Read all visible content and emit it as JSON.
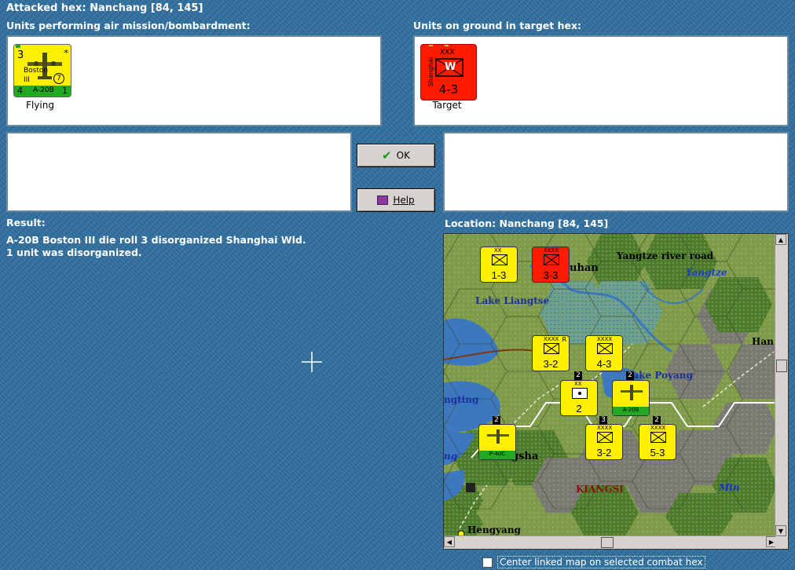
{
  "header": {
    "attacked_hex": "Attacked hex: Nanchang  [84, 145]"
  },
  "left_panel": {
    "title": "Units performing air mission/bombardment:",
    "unit": {
      "top_left": "3",
      "star": "*",
      "name": "Boston",
      "sub": "III",
      "range": "7",
      "bottom_left": "4",
      "type": "A-20B",
      "bottom_right": "1",
      "caption": "Flying"
    }
  },
  "right_panel": {
    "title": "Units on ground in target hex:",
    "unit": {
      "size": "XXX",
      "side_label": "Shanghai",
      "symbol": "W",
      "strength": "4-3",
      "caption": "Target"
    }
  },
  "buttons": {
    "ok": "OK",
    "help": "Help"
  },
  "result": {
    "title": "Result:",
    "line1": "A-20B Boston III die roll 3 disorganized Shanghai Wld.",
    "line2": "1 unit was disorganized."
  },
  "location": {
    "label": "Location:  Nanchang  [84, 145]"
  },
  "map": {
    "labels": {
      "yangtze_road": "Yangtze river road",
      "yangtze": "Yangtze",
      "han": "Han",
      "lake_liangtse": "Lake Liangtse",
      "lake_poyang": "Lake Poyang",
      "ngting": "ngting",
      "ng": "ng",
      "gsha": "gsha",
      "kiangsi": "KIANGSI",
      "min": "Min",
      "hengyang": "Hengyang",
      "uhan": "uhan"
    },
    "counters": [
      {
        "id": "c1",
        "size": "XX",
        "strength": "1-3"
      },
      {
        "id": "c2",
        "size": "XXXX",
        "strength": "3-3"
      },
      {
        "id": "c3",
        "size": "XXXX",
        "strength": "3-2",
        "extra": "R"
      },
      {
        "id": "c4",
        "size": "XXXX",
        "strength": "4-3"
      },
      {
        "id": "c5",
        "size": "XX",
        "strength": "2"
      },
      {
        "id": "c6",
        "size": "",
        "strength": "A-20B"
      },
      {
        "id": "c7",
        "size": "",
        "strength": "P-40C"
      },
      {
        "id": "c8",
        "size": "XXXX",
        "strength": "3-2"
      },
      {
        "id": "c9",
        "size": "XXXX",
        "strength": "5-3"
      }
    ],
    "stack_counts": {
      "s1": "2",
      "s2": "2",
      "s3": "3",
      "s4": "2",
      "s5": "2"
    }
  },
  "checkbox": {
    "label": "Center linked map on selected combat hex"
  },
  "colors": {
    "background": "#2f6f9f",
    "axis_yellow": "#ffef00",
    "chinese_red": "#ff1a00",
    "strength_green": "#22a822"
  }
}
